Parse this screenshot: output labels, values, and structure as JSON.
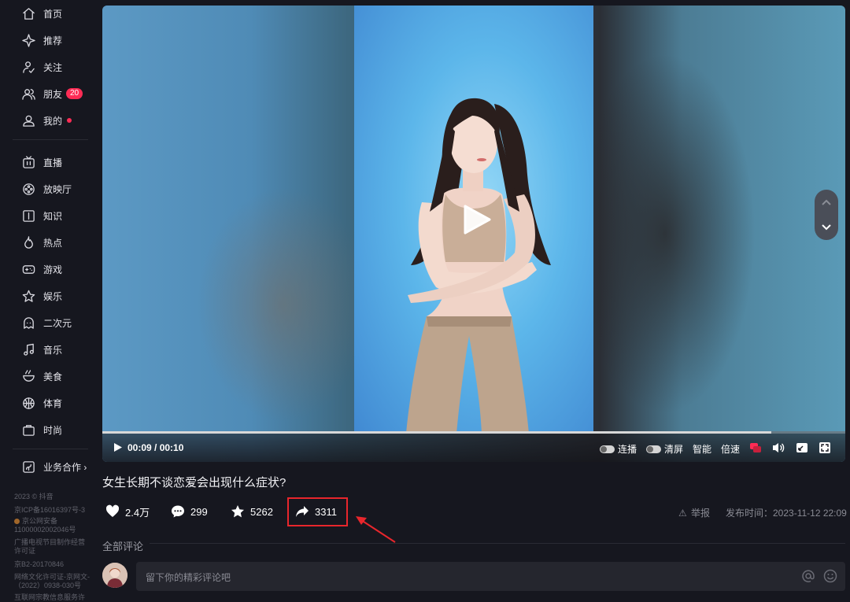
{
  "sidebar": {
    "items": [
      {
        "label": "首页",
        "icon": "home-icon"
      },
      {
        "label": "推荐",
        "icon": "sparkle-icon"
      },
      {
        "label": "关注",
        "icon": "follow-icon"
      },
      {
        "label": "朋友",
        "icon": "friends-icon",
        "badge": "20"
      },
      {
        "label": "我的",
        "icon": "user-icon",
        "dot": true
      },
      {
        "label": "直播",
        "icon": "tv-icon"
      },
      {
        "label": "放映厅",
        "icon": "film-reel-icon"
      },
      {
        "label": "知识",
        "icon": "book-icon"
      },
      {
        "label": "热点",
        "icon": "flame-icon"
      },
      {
        "label": "游戏",
        "icon": "gamepad-icon"
      },
      {
        "label": "娱乐",
        "icon": "star-icon"
      },
      {
        "label": "二次元",
        "icon": "anime-ghost-icon"
      },
      {
        "label": "音乐",
        "icon": "music-note-icon"
      },
      {
        "label": "美食",
        "icon": "bowl-icon"
      },
      {
        "label": "体育",
        "icon": "basketball-icon"
      },
      {
        "label": "时尚",
        "icon": "bag-icon"
      }
    ],
    "business": "业务合作 ›",
    "footer": [
      "2023 © 抖音",
      "京ICP备16016397号-3",
      "京公网安备",
      "11000002002046号",
      "广播电视节目制作经营",
      "许可证",
      "京B2-20170846",
      "网络文化许可证-京网文-",
      "（2022）0938-030号",
      "互联网宗教信息服务许"
    ]
  },
  "player": {
    "time": "00:09 / 00:10",
    "progress": 0.9,
    "toggle_continuous": "连播",
    "toggle_clear": "清屏",
    "smart": "智能",
    "speed": "倍速"
  },
  "video": {
    "title": "女生长期不谈恋爱会出现什么症状?"
  },
  "actions": {
    "likes": "2.4万",
    "comments": "299",
    "favorites": "5262",
    "shares": "3311",
    "report": "举报",
    "publish_time": "发布时间：2023-11-12 22:09"
  },
  "comments": {
    "header": "全部评论",
    "placeholder": "留下你的精彩评论吧"
  },
  "colors": {
    "accent": "#fe2c55",
    "highlight_box": "#e8262c",
    "background": "#16171f"
  }
}
